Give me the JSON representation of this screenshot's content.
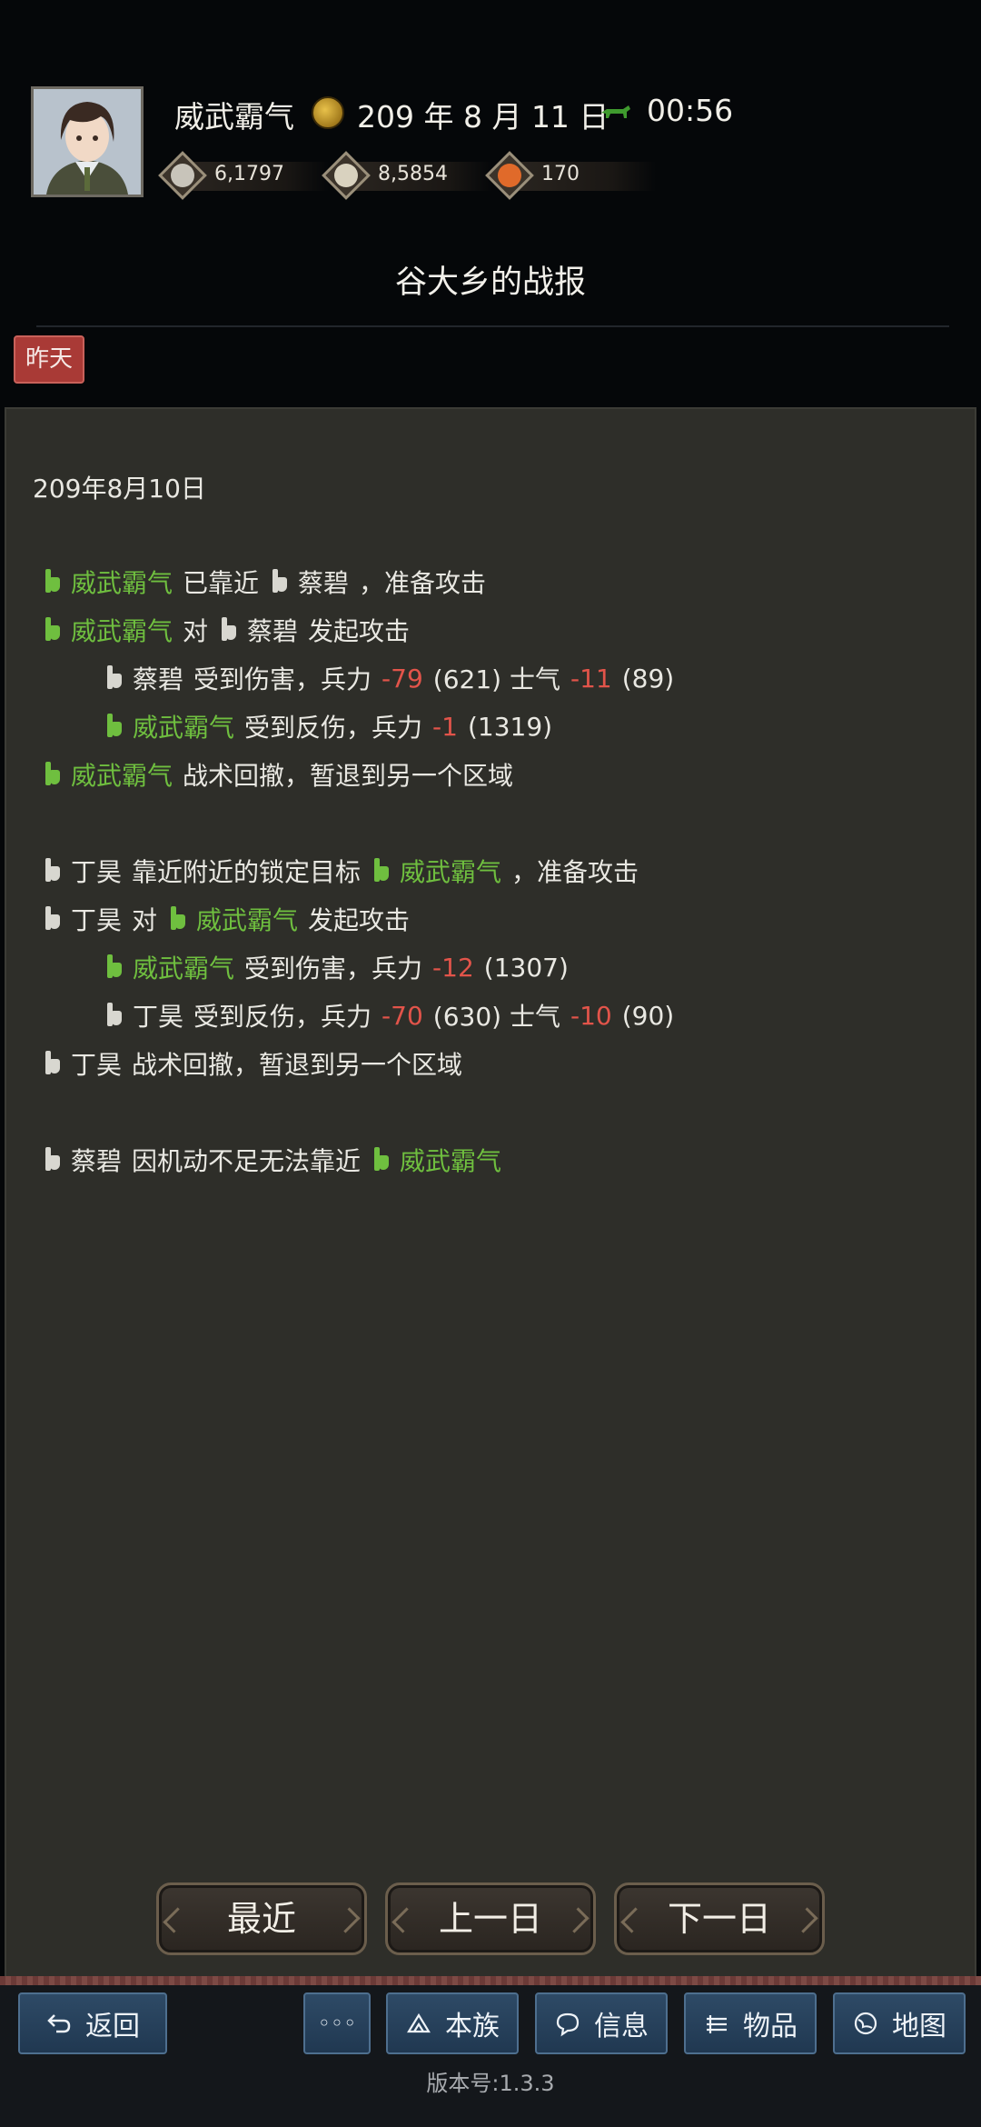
{
  "header": {
    "player_name": "威武霸气",
    "date": "209 年 8 月 11 日",
    "time": "00:56",
    "date_icon": "sun-coin-icon",
    "time_icon": "horse-icon"
  },
  "resources": [
    {
      "name": "silver-icon",
      "value": "6,1797"
    },
    {
      "name": "grain-icon",
      "value": "8,5854"
    },
    {
      "name": "medal-icon",
      "value": "170"
    }
  ],
  "report": {
    "title": "谷大乡的战报",
    "filter_badge": "昨天",
    "date": "209年8月10日",
    "lines": [
      {
        "a": "威武霸气",
        "b": "已靠近",
        "c": "蔡碧",
        "d": "，准备攻击"
      },
      {
        "a": "威武霸气",
        "b": "对",
        "c": "蔡碧",
        "d": "发起攻击"
      },
      {
        "a": "蔡碧",
        "b": "受到伤害，兵力",
        "c": "-79",
        "d": "(621) 士气",
        "e": "-11",
        "f": "(89)"
      },
      {
        "a": "威武霸气",
        "b": "受到反伤，兵力",
        "c": "-1",
        "d": "(1319)"
      },
      {
        "a": "威武霸气",
        "b": "战术回撤，暂退到另一个区域"
      },
      {
        "a": "丁昊",
        "b": "靠近附近的锁定目标",
        "c": "威武霸气",
        "d": "，准备攻击"
      },
      {
        "a": "丁昊",
        "b": "对",
        "c": "威武霸气",
        "d": "发起攻击"
      },
      {
        "a": "威武霸气",
        "b": "受到伤害，兵力",
        "c": "-12",
        "d": "(1307)"
      },
      {
        "a": "丁昊",
        "b": "受到反伤，兵力",
        "c": "-70",
        "d": "(630) 士气",
        "e": "-10",
        "f": "(90)"
      },
      {
        "a": "丁昊",
        "b": "战术回撤，暂退到另一个区域"
      },
      {
        "a": "蔡碧",
        "b": "因机动不足无法靠近",
        "c": "威武霸气"
      }
    ]
  },
  "day_buttons": {
    "recent": "最近",
    "prev": "上一日",
    "next": "下一日"
  },
  "nav": {
    "back": "返回",
    "more": "◦◦◦",
    "clan": "本族",
    "info": "信息",
    "items": "物品",
    "map": "地图"
  },
  "version": "版本号:1.3.3"
}
